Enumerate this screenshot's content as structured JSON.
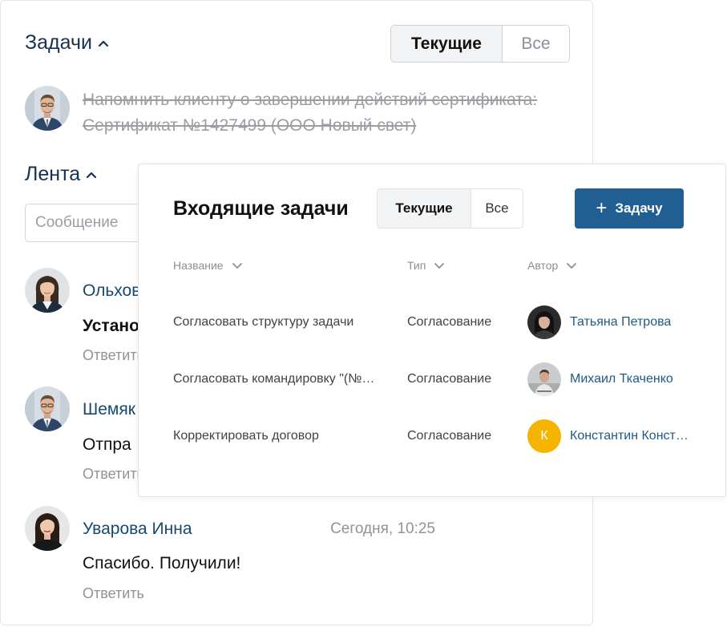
{
  "back": {
    "tasks_title": "Задачи",
    "seg_current": "Текущие",
    "seg_all": "Все",
    "task_text": "Напомнить клиенту о завершении действий сертификата: Сертификат №1427499 (ООО Новый свет)",
    "feed_title": "Лента",
    "message_placeholder": "Сообщение",
    "feed": [
      {
        "name": "Ольхов",
        "text": "Устано",
        "reply": "Ответить"
      },
      {
        "name": "Шемяк",
        "text": "Отпра",
        "reply": "Ответить"
      },
      {
        "name": "Уварова Инна",
        "text": "Спасибо. Получили!",
        "reply": "Ответить",
        "time": "Сегодня, 10:25"
      }
    ]
  },
  "incoming": {
    "title": "Входящие задачи",
    "seg_current": "Текущие",
    "seg_all": "Все",
    "add_label": "Задачу",
    "add_icon": "plus-icon",
    "columns": {
      "name": "Название",
      "type": "Тип",
      "author": "Автор"
    },
    "rows": [
      {
        "name": "Согласовать структуру задачи",
        "type": "Согласование",
        "author": "Татьяна Петрова",
        "avatar": "photo"
      },
      {
        "name": "Согласовать командировку \"(№…",
        "type": "Согласование",
        "author": "Михаил Ткаченко",
        "avatar": "photo"
      },
      {
        "name": "Корректировать договор",
        "type": "Согласование",
        "author": "Константин Конст…",
        "avatar_letter": "К",
        "avatar_color": "#f5b400"
      }
    ]
  },
  "colors": {
    "accent": "#215f93",
    "link": "#17496e",
    "title": "#17324f"
  }
}
